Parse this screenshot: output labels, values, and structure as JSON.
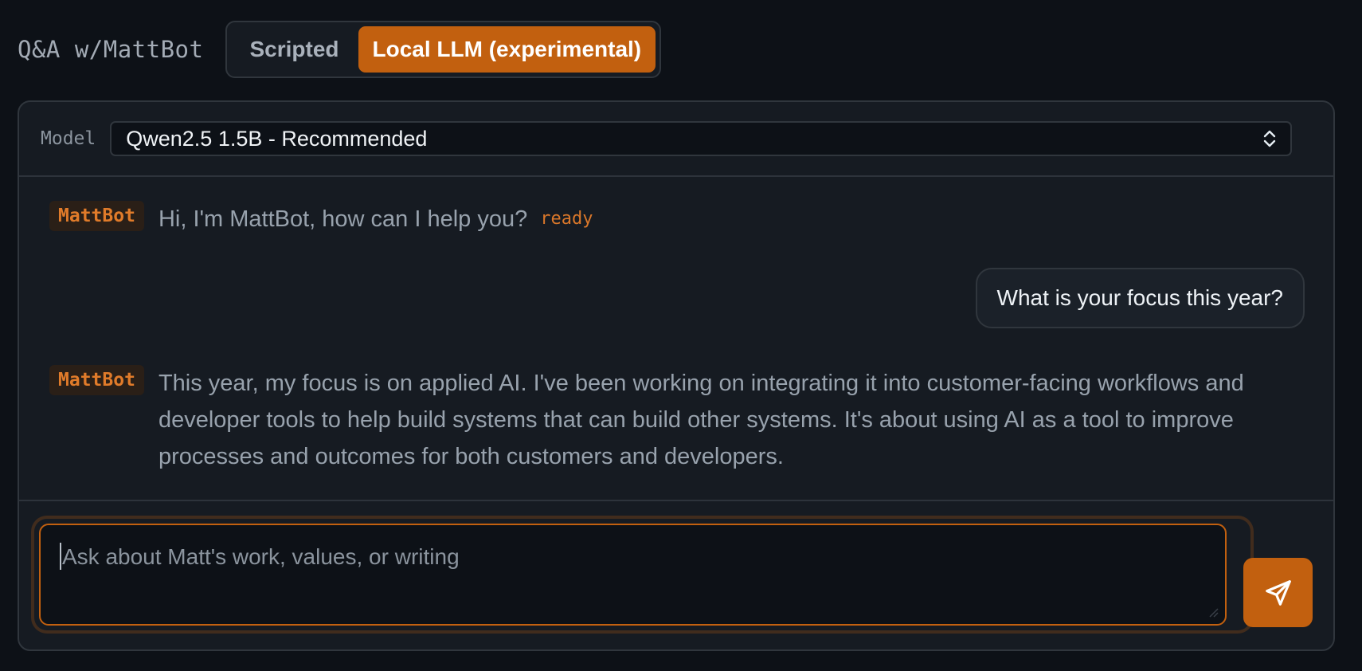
{
  "header": {
    "title": "Q&A w/MattBot",
    "modes": [
      {
        "label": "Scripted",
        "active": false
      },
      {
        "label": "Local LLM (experimental)",
        "active": true
      }
    ]
  },
  "model": {
    "label": "Model",
    "selected": "Qwen2.5 1.5B - Recommended"
  },
  "messages": [
    {
      "role": "bot",
      "name": "MattBot",
      "text": "Hi, I'm MattBot, how can I help you?",
      "status": "ready"
    },
    {
      "role": "user",
      "text": "What is your focus this year?"
    },
    {
      "role": "bot",
      "name": "MattBot",
      "text": "This year, my focus is on applied AI. I've been working on integrating it into customer-facing workflows and developer tools to help build systems that can build other systems. It's about using AI as a tool to improve processes and outcomes for both customers and developers."
    }
  ],
  "composer": {
    "placeholder": "Ask about Matt's work, values, or writing",
    "send_icon": "send-icon"
  },
  "colors": {
    "accent": "#c2600f",
    "background": "#0d1117",
    "panel": "#161b22"
  }
}
